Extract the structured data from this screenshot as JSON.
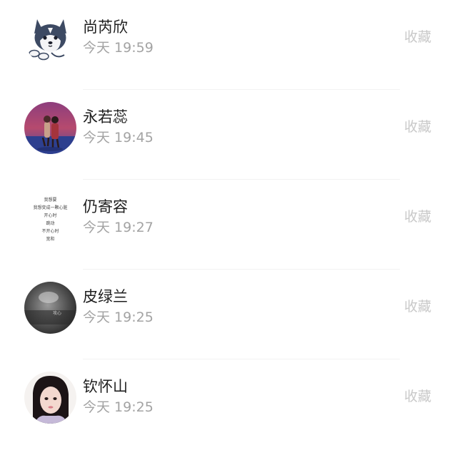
{
  "list": {
    "items": [
      {
        "name": "尚芮欣",
        "time": "今天 19:59",
        "action": "收藏",
        "avatar": "husky-dog-icon"
      },
      {
        "name": "永若蕊",
        "time": "今天 19:45",
        "action": "收藏",
        "avatar": "couple-photo-avatar"
      },
      {
        "name": "仍寄容",
        "time": "今天 19:27",
        "action": "收藏",
        "avatar": "text-poem-avatar",
        "avatar_text": [
          "我想要",
          "我想变成一颗心脏",
          "开心时",
          "跳动",
          "不开心时",
          "宽和"
        ]
      },
      {
        "name": "皮绿兰",
        "time": "今天 19:25",
        "action": "收藏",
        "avatar": "dark-photo-avatar",
        "avatar_caption": "攻心"
      },
      {
        "name": "钦怀山",
        "time": "今天 19:25",
        "action": "收藏",
        "avatar": "girl-portrait-avatar"
      }
    ]
  },
  "colors": {
    "name": "#1e1e1e",
    "time": "#a3a3a3",
    "action": "#c9c9c9",
    "divider": "#f2f2f2"
  }
}
